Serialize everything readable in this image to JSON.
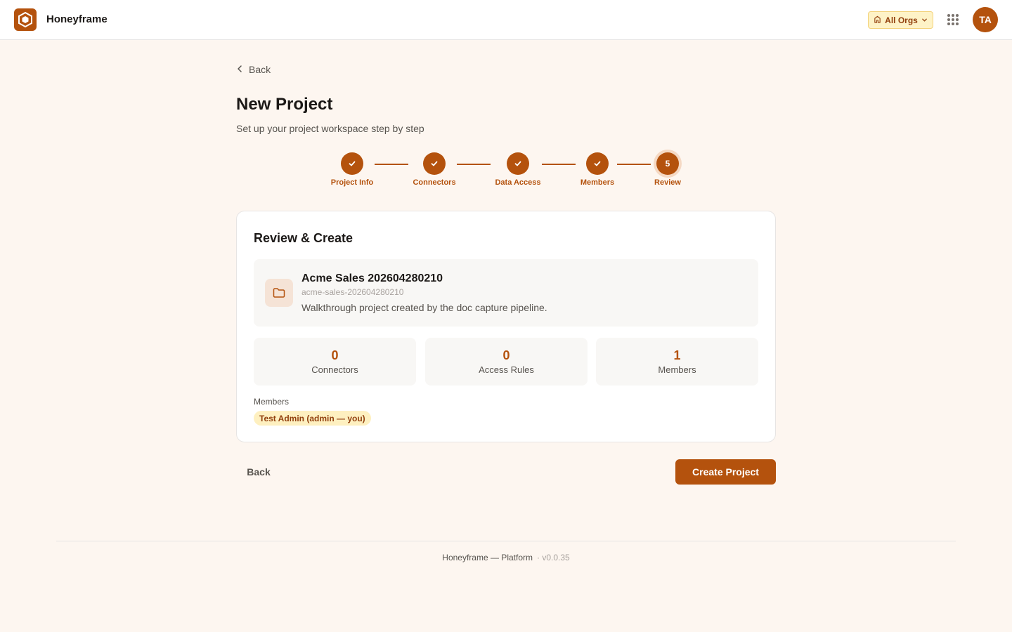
{
  "app": {
    "name": "Honeyframe"
  },
  "header": {
    "org_switcher_label": "All Orgs",
    "avatar_initials": "TA"
  },
  "page": {
    "back_link": "Back",
    "title": "New Project",
    "subtitle": "Set up your project workspace step by step"
  },
  "steps": [
    {
      "label": "Project Info",
      "status": "complete"
    },
    {
      "label": "Connectors",
      "status": "complete"
    },
    {
      "label": "Data Access",
      "status": "complete"
    },
    {
      "label": "Members",
      "status": "complete"
    },
    {
      "label": "Review",
      "status": "current",
      "number": "5"
    }
  ],
  "review": {
    "title": "Review & Create",
    "project": {
      "name": "Acme Sales 202604280210",
      "slug": "acme-sales-202604280210",
      "description": "Walkthrough project created by the doc capture pipeline."
    },
    "stats": [
      {
        "value": "0",
        "label": "Connectors"
      },
      {
        "value": "0",
        "label": "Access Rules"
      },
      {
        "value": "1",
        "label": "Members"
      }
    ],
    "members_label": "Members",
    "members": [
      "Test Admin (admin — you)"
    ]
  },
  "actions": {
    "back_label": "Back",
    "create_label": "Create Project"
  },
  "footer": {
    "text": "Honeyframe — Platform",
    "version": "· v0.0.35"
  },
  "colors": {
    "accent": "#b4520d",
    "background": "#fdf6f0",
    "chip_bg": "#fef0c0"
  }
}
